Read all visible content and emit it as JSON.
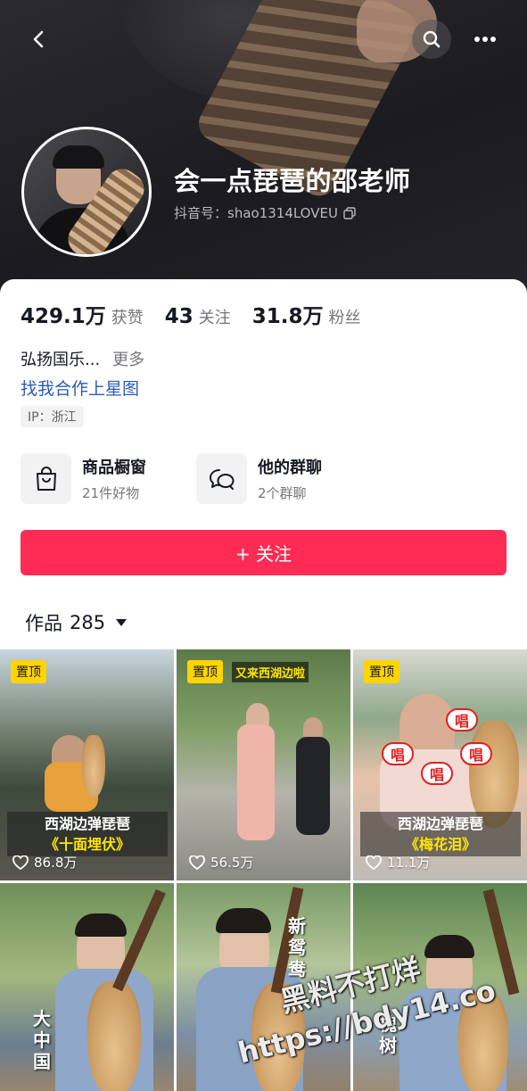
{
  "header": {
    "username": "会一点琵琶的邵老师",
    "douyin_id": "抖音号：shao1314LOVEU",
    "icons": [
      "back-icon",
      "search-icon",
      "more-icon",
      "copy-icon"
    ]
  },
  "stats": [
    {
      "num": "429.1万",
      "label": "获赞"
    },
    {
      "num": "43",
      "label": "关注"
    },
    {
      "num": "31.8万",
      "label": "粉丝"
    }
  ],
  "bio": {
    "text": "弘扬国乐...",
    "more": "更多",
    "link": "找我合作上星图",
    "ip": "IP：浙江"
  },
  "features": {
    "shop": {
      "title": "商品橱窗",
      "sub": "21件好物",
      "icon": "shopping-bag-icon"
    },
    "group": {
      "title": "他的群聊",
      "sub": "2个群聊",
      "icon": "chat-bubbles-icon"
    }
  },
  "follow_button": "+ 关注",
  "works": {
    "label": "作品",
    "count": "285"
  },
  "videos": [
    {
      "pinned": "置顶",
      "title": "西湖边弹琵琶",
      "subtitle": "《十面埋伏》",
      "likes": "86.8万",
      "caption": ""
    },
    {
      "pinned": "置顶",
      "title": "",
      "subtitle": "",
      "likes": "56.5万",
      "caption": "又来西湖边啦"
    },
    {
      "pinned": "置顶",
      "title": "西湖边弹琵琶",
      "subtitle": "《梅花泪》",
      "likes": "11.1万",
      "caption": ""
    },
    {
      "pinned": "",
      "title": "",
      "subtitle": "",
      "likes": "",
      "caption": "大中国"
    },
    {
      "pinned": "",
      "title": "",
      "subtitle": "",
      "likes": "",
      "caption": "新鸳鸯"
    },
    {
      "pinned": "",
      "title": "",
      "subtitle": "",
      "likes": "",
      "caption": "槐树"
    }
  ],
  "bubble_text": "唱",
  "watermark": {
    "line1": "黑料不打烊",
    "line2": "https://bdy14.co"
  },
  "colors": {
    "accent": "#fe2c55",
    "link": "#2b5ab8",
    "pin": "#ffd400"
  }
}
